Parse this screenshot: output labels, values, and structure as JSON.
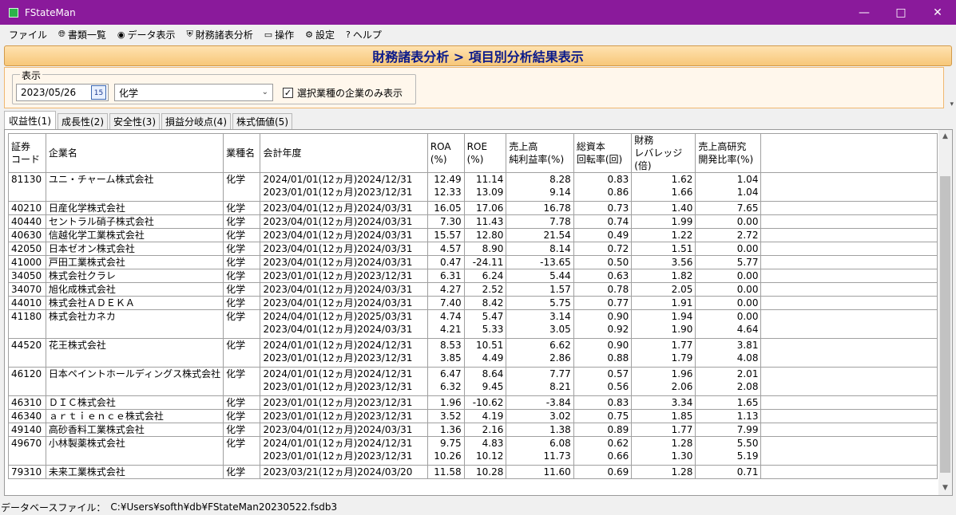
{
  "window": {
    "title": "FStateMan"
  },
  "menu": [
    {
      "label": "ファイル",
      "icon": ""
    },
    {
      "label": "書類一覧",
      "icon": "globe-icon"
    },
    {
      "label": "データ表示",
      "icon": "eye-icon"
    },
    {
      "label": "財務諸表分析",
      "icon": "shield-icon"
    },
    {
      "label": "操作",
      "icon": "screen-icon"
    },
    {
      "label": "設定",
      "icon": "gear-icon"
    },
    {
      "label": "ヘルプ",
      "icon": "question-icon"
    }
  ],
  "banner": {
    "title": "財務諸表分析 > 項目別分析結果表示"
  },
  "filter": {
    "group_label": "表示",
    "date": "2023/05/26",
    "calendar_text": "15",
    "industry": "化学",
    "only_selected_label": "選択業種の企業のみ表示",
    "only_selected_checked": true
  },
  "tabs": [
    {
      "label": "収益性(1)",
      "active": true
    },
    {
      "label": "成長性(2)",
      "active": false
    },
    {
      "label": "安全性(3)",
      "active": false
    },
    {
      "label": "損益分岐点(4)",
      "active": false
    },
    {
      "label": "株式価値(5)",
      "active": false
    }
  ],
  "columns": [
    "証券\nコード",
    "企業名",
    "業種名",
    "会計年度",
    "ROA\n(%)",
    "ROE\n(%)",
    "売上高\n純利益率(%)",
    "総資本\n回転率(回)",
    "財務\nレバレッジ(倍)",
    "売上高研究\n開発比率(%)"
  ],
  "rows": [
    {
      "code": "81130",
      "name": "ユニ・チャーム株式会社",
      "industry": "化学",
      "years": [
        "2024/01/01(12ヵ月)2024/12/31",
        "2023/01/01(12ヵ月)2023/12/31"
      ],
      "roa": [
        "12.49",
        "12.33"
      ],
      "roe": [
        "11.14",
        "13.09"
      ],
      "npm": [
        "8.28",
        "9.14"
      ],
      "turn": [
        "0.83",
        "0.86"
      ],
      "lev": [
        "1.62",
        "1.66"
      ],
      "rd": [
        "1.04",
        "1.04"
      ]
    },
    {
      "code": "40210",
      "name": "日産化学株式会社",
      "industry": "化学",
      "years": [
        "2023/04/01(12ヵ月)2024/03/31"
      ],
      "roa": [
        "16.05"
      ],
      "roe": [
        "17.06"
      ],
      "npm": [
        "16.78"
      ],
      "turn": [
        "0.73"
      ],
      "lev": [
        "1.40"
      ],
      "rd": [
        "7.65"
      ]
    },
    {
      "code": "40440",
      "name": "セントラル硝子株式会社",
      "industry": "化学",
      "years": [
        "2023/04/01(12ヵ月)2024/03/31"
      ],
      "roa": [
        "7.30"
      ],
      "roe": [
        "11.43"
      ],
      "npm": [
        "7.78"
      ],
      "turn": [
        "0.74"
      ],
      "lev": [
        "1.99"
      ],
      "rd": [
        "0.00"
      ]
    },
    {
      "code": "40630",
      "name": "信越化学工業株式会社",
      "industry": "化学",
      "years": [
        "2023/04/01(12ヵ月)2024/03/31"
      ],
      "roa": [
        "15.57"
      ],
      "roe": [
        "12.80"
      ],
      "npm": [
        "21.54"
      ],
      "turn": [
        "0.49"
      ],
      "lev": [
        "1.22"
      ],
      "rd": [
        "2.72"
      ]
    },
    {
      "code": "42050",
      "name": "日本ゼオン株式会社",
      "industry": "化学",
      "years": [
        "2023/04/01(12ヵ月)2024/03/31"
      ],
      "roa": [
        "4.57"
      ],
      "roe": [
        "8.90"
      ],
      "npm": [
        "8.14"
      ],
      "turn": [
        "0.72"
      ],
      "lev": [
        "1.51"
      ],
      "rd": [
        "0.00"
      ]
    },
    {
      "code": "41000",
      "name": "戸田工業株式会社",
      "industry": "化学",
      "years": [
        "2023/04/01(12ヵ月)2024/03/31"
      ],
      "roa": [
        "0.47"
      ],
      "roe": [
        "-24.11"
      ],
      "npm": [
        "-13.65"
      ],
      "turn": [
        "0.50"
      ],
      "lev": [
        "3.56"
      ],
      "rd": [
        "5.77"
      ]
    },
    {
      "code": "34050",
      "name": "株式会社クラレ",
      "industry": "化学",
      "years": [
        "2023/01/01(12ヵ月)2023/12/31"
      ],
      "roa": [
        "6.31"
      ],
      "roe": [
        "6.24"
      ],
      "npm": [
        "5.44"
      ],
      "turn": [
        "0.63"
      ],
      "lev": [
        "1.82"
      ],
      "rd": [
        "0.00"
      ]
    },
    {
      "code": "34070",
      "name": "旭化成株式会社",
      "industry": "化学",
      "years": [
        "2023/04/01(12ヵ月)2024/03/31"
      ],
      "roa": [
        "4.27"
      ],
      "roe": [
        "2.52"
      ],
      "npm": [
        "1.57"
      ],
      "turn": [
        "0.78"
      ],
      "lev": [
        "2.05"
      ],
      "rd": [
        "0.00"
      ]
    },
    {
      "code": "44010",
      "name": "株式会社ＡＤＥＫＡ",
      "industry": "化学",
      "years": [
        "2023/04/01(12ヵ月)2024/03/31"
      ],
      "roa": [
        "7.40"
      ],
      "roe": [
        "8.42"
      ],
      "npm": [
        "5.75"
      ],
      "turn": [
        "0.77"
      ],
      "lev": [
        "1.91"
      ],
      "rd": [
        "0.00"
      ]
    },
    {
      "code": "41180",
      "name": "株式会社カネカ",
      "industry": "化学",
      "years": [
        "2024/04/01(12ヵ月)2025/03/31",
        "2023/04/01(12ヵ月)2024/03/31"
      ],
      "roa": [
        "4.74",
        "4.21"
      ],
      "roe": [
        "5.47",
        "5.33"
      ],
      "npm": [
        "3.14",
        "3.05"
      ],
      "turn": [
        "0.90",
        "0.92"
      ],
      "lev": [
        "1.94",
        "1.90"
      ],
      "rd": [
        "0.00",
        "4.64"
      ]
    },
    {
      "code": "44520",
      "name": "花王株式会社",
      "industry": "化学",
      "years": [
        "2024/01/01(12ヵ月)2024/12/31",
        "2023/01/01(12ヵ月)2023/12/31"
      ],
      "roa": [
        "8.53",
        "3.85"
      ],
      "roe": [
        "10.51",
        "4.49"
      ],
      "npm": [
        "6.62",
        "2.86"
      ],
      "turn": [
        "0.90",
        "0.88"
      ],
      "lev": [
        "1.77",
        "1.79"
      ],
      "rd": [
        "3.81",
        "4.08"
      ]
    },
    {
      "code": "46120",
      "name": "日本ペイントホールディングス株式会社",
      "industry": "化学",
      "years": [
        "2024/01/01(12ヵ月)2024/12/31",
        "2023/01/01(12ヵ月)2023/12/31"
      ],
      "roa": [
        "6.47",
        "6.32"
      ],
      "roe": [
        "8.64",
        "9.45"
      ],
      "npm": [
        "7.77",
        "8.21"
      ],
      "turn": [
        "0.57",
        "0.56"
      ],
      "lev": [
        "1.96",
        "2.06"
      ],
      "rd": [
        "2.01",
        "2.08"
      ]
    },
    {
      "code": "46310",
      "name": "ＤＩＣ株式会社",
      "industry": "化学",
      "years": [
        "2023/01/01(12ヵ月)2023/12/31"
      ],
      "roa": [
        "1.96"
      ],
      "roe": [
        "-10.62"
      ],
      "npm": [
        "-3.84"
      ],
      "turn": [
        "0.83"
      ],
      "lev": [
        "3.34"
      ],
      "rd": [
        "1.65"
      ]
    },
    {
      "code": "46340",
      "name": "ａｒｔｉｅｎｃｅ株式会社",
      "industry": "化学",
      "years": [
        "2023/01/01(12ヵ月)2023/12/31"
      ],
      "roa": [
        "3.52"
      ],
      "roe": [
        "4.19"
      ],
      "npm": [
        "3.02"
      ],
      "turn": [
        "0.75"
      ],
      "lev": [
        "1.85"
      ],
      "rd": [
        "1.13"
      ]
    },
    {
      "code": "49140",
      "name": "高砂香料工業株式会社",
      "industry": "化学",
      "years": [
        "2023/04/01(12ヵ月)2024/03/31"
      ],
      "roa": [
        "1.36"
      ],
      "roe": [
        "2.16"
      ],
      "npm": [
        "1.38"
      ],
      "turn": [
        "0.89"
      ],
      "lev": [
        "1.77"
      ],
      "rd": [
        "7.99"
      ]
    },
    {
      "code": "49670",
      "name": "小林製薬株式会社",
      "industry": "化学",
      "years": [
        "2024/01/01(12ヵ月)2024/12/31",
        "2023/01/01(12ヵ月)2023/12/31"
      ],
      "roa": [
        "9.75",
        "10.26"
      ],
      "roe": [
        "4.83",
        "10.12"
      ],
      "npm": [
        "6.08",
        "11.73"
      ],
      "turn": [
        "0.62",
        "0.66"
      ],
      "lev": [
        "1.28",
        "1.30"
      ],
      "rd": [
        "5.50",
        "5.19"
      ]
    },
    {
      "code": "79310",
      "name": "未来工業株式会社",
      "industry": "化学",
      "years": [
        "2023/03/21(12ヵ月)2024/03/20"
      ],
      "roa": [
        "11.58"
      ],
      "roe": [
        "10.28"
      ],
      "npm": [
        "11.60"
      ],
      "turn": [
        "0.69"
      ],
      "lev": [
        "1.28"
      ],
      "rd": [
        "0.71"
      ]
    }
  ],
  "status": {
    "db_label": "データベースファイル：",
    "db_path": "C:¥Users¥softh¥db¥FStateMan20230522.fsdb3"
  },
  "colors": {
    "titlebar": "#8a1a9b",
    "banner_text": "#0b1a8a",
    "banner_bg": "#f7c779"
  }
}
